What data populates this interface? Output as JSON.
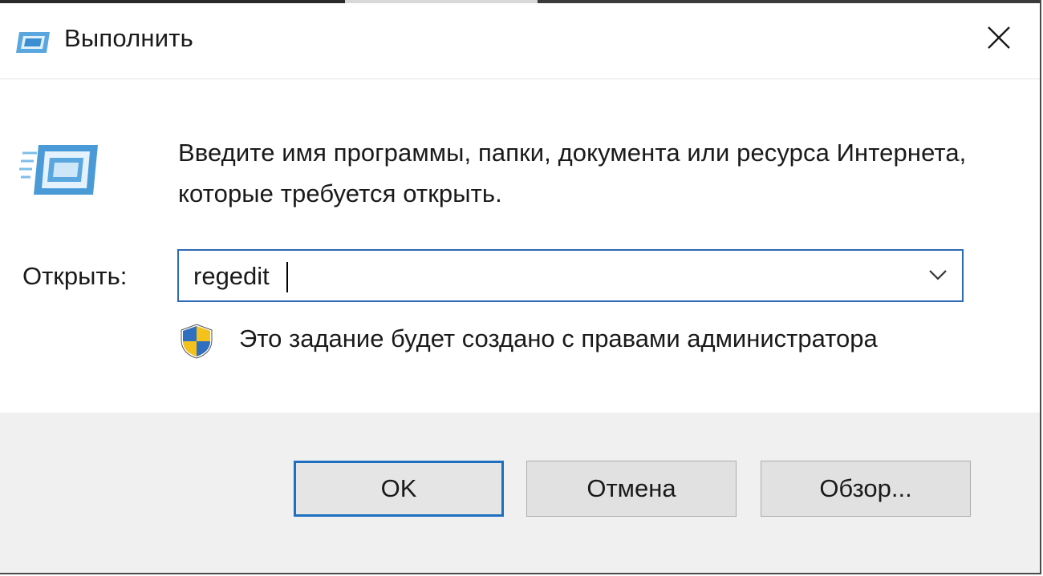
{
  "window": {
    "title": "Выполнить",
    "close_symbol": "✕"
  },
  "description": "Введите имя программы, папки, документа или ресурса Интернета, которые требуется открыть.",
  "open_field": {
    "label": "Открыть:",
    "value": "regedit"
  },
  "admin_note": "Это задание будет создано с правами администратора",
  "buttons": {
    "ok": "OK",
    "cancel": "Отмена",
    "browse": "Обзор..."
  },
  "icons": {
    "title": "run-icon",
    "large": "run-icon",
    "shield": "uac-shield-icon",
    "close": "close-icon",
    "dropdown": "chevron-down-icon"
  },
  "colors": {
    "accent": "#1e6fbf",
    "footer_bg": "#f0f0f0",
    "button_bg": "#e1e1e1"
  }
}
